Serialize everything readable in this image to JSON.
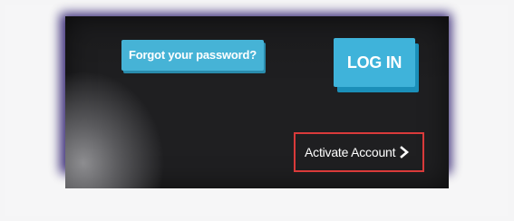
{
  "login": {
    "forgot_label": "Forgot your password?",
    "login_label": "LOG IN",
    "activate_label": "Activate Account",
    "activate_icon": "chevron-right-icon"
  },
  "colors": {
    "button_blue": "#46b3d6",
    "highlight_red": "#d93a3a",
    "panel_dark": "#1f1f21"
  }
}
